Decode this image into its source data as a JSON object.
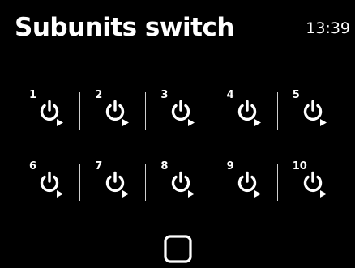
{
  "header": {
    "title": "Subunits switch",
    "time": "13:39"
  },
  "units": [
    {
      "label": "1",
      "icon": "power-icon"
    },
    {
      "label": "2",
      "icon": "power-icon"
    },
    {
      "label": "3",
      "icon": "power-icon"
    },
    {
      "label": "4",
      "icon": "power-icon"
    },
    {
      "label": "5",
      "icon": "power-icon"
    },
    {
      "label": "6",
      "icon": "power-icon"
    },
    {
      "label": "7",
      "icon": "power-icon"
    },
    {
      "label": "8",
      "icon": "power-icon"
    },
    {
      "label": "9",
      "icon": "power-icon"
    },
    {
      "label": "10",
      "icon": "power-icon"
    }
  ],
  "footer": {
    "button_icon": "square-icon"
  },
  "colors": {
    "background": "#000000",
    "foreground": "#ffffff",
    "divider": "#cfcfcf"
  }
}
